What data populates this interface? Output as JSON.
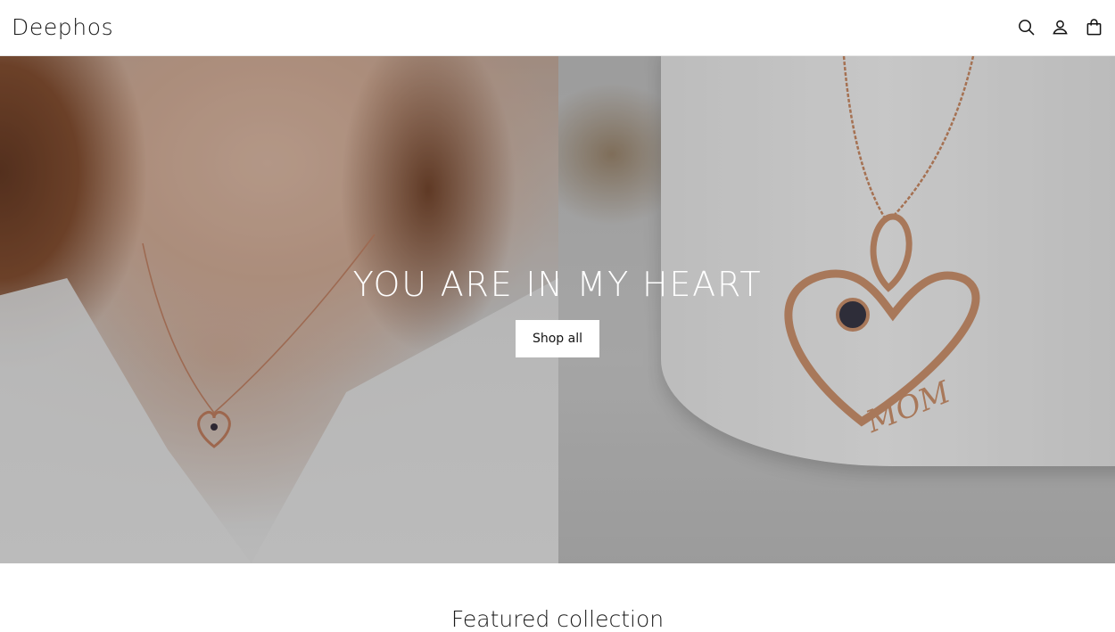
{
  "header": {
    "logo": "Deephos",
    "icons": [
      "search-icon",
      "account-icon",
      "cart-icon"
    ]
  },
  "hero": {
    "title": "YOU ARE IN MY HEART",
    "button_label": "Shop all",
    "pendant_engraving": "MOM"
  },
  "featured": {
    "title": "Featured collection"
  },
  "colors": {
    "text": "#121212",
    "background": "#ffffff",
    "rose_gold": "#d4916a"
  }
}
